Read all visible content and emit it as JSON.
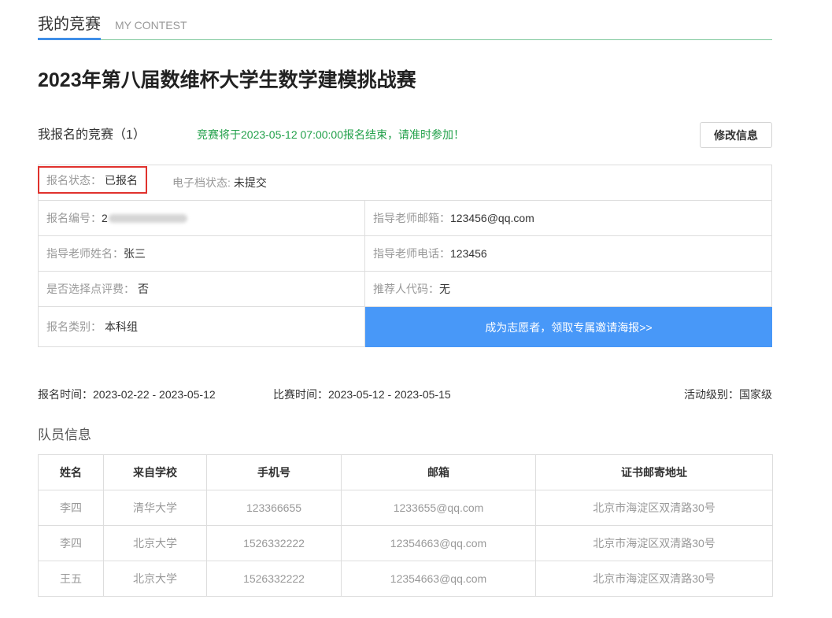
{
  "header": {
    "tab_active": "我的竞赛",
    "tab_en": "MY CONTEST"
  },
  "title": "2023年第八届数维杯大学生数学建模挑战赛",
  "registration": {
    "heading": "我报名的竞赛（1）",
    "notice": "竞赛将于2023-05-12 07:00:00报名结束，请准时参加！",
    "edit_button": "修改信息"
  },
  "info": {
    "status": {
      "label": "报名状态：",
      "value": "已报名"
    },
    "file_status": {
      "label": "电子档状态:",
      "value": "未提交"
    },
    "reg_no": {
      "label": "报名编号：",
      "value": "2"
    },
    "teacher_email": {
      "label": "指导老师邮箱：",
      "value": "123456@qq.com"
    },
    "teacher_name": {
      "label": "指导老师姓名：",
      "value": "张三"
    },
    "teacher_phone": {
      "label": "指导老师电话：",
      "value": "123456"
    },
    "review_fee": {
      "label": "是否选择点评费：",
      "value": "否"
    },
    "referrer_code": {
      "label": "推荐人代码：",
      "value": "无"
    },
    "category": {
      "label": "报名类别：",
      "value": "本科组"
    },
    "volunteer_link": "成为志愿者，领取专属邀请海报>>"
  },
  "meta": {
    "reg_time": {
      "label": "报名时间：",
      "value": "2023-02-22 - 2023-05-12"
    },
    "contest_time": {
      "label": "比赛时间：",
      "value": "2023-05-12 - 2023-05-15"
    },
    "level": {
      "label": "活动级别：",
      "value": "国家级"
    }
  },
  "team": {
    "title": "队员信息",
    "columns": [
      "姓名",
      "来自学校",
      "手机号",
      "邮箱",
      "证书邮寄地址"
    ],
    "rows": [
      {
        "name": "李四",
        "school": "清华大学",
        "phone": "123366655",
        "email": "1233655@qq.com",
        "address": "北京市海淀区双清路30号"
      },
      {
        "name": "李四",
        "school": "北京大学",
        "phone": "1526332222",
        "email": "12354663@qq.com",
        "address": "北京市海淀区双清路30号"
      },
      {
        "name": "王五",
        "school": "北京大学",
        "phone": "1526332222",
        "email": "12354663@qq.com",
        "address": "北京市海淀区双清路30号"
      }
    ]
  },
  "colors": {
    "accent": "#3f8ee8",
    "notice": "#21a04a",
    "highlight": "#e0322d",
    "volunteer": "#4898f8",
    "divider": "#7cc79a"
  }
}
